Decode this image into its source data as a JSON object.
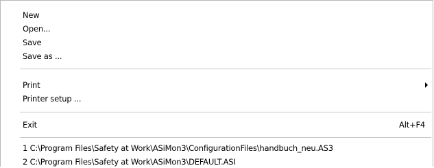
{
  "menu": {
    "items": [
      {
        "label": "New"
      },
      {
        "label": "Open..."
      },
      {
        "label": "Save"
      },
      {
        "label": "Save as ..."
      },
      {
        "label": "Print"
      },
      {
        "label": "Printer setup ..."
      },
      {
        "label": "Exit",
        "shortcut": "Alt+F4"
      },
      {
        "label": "1 C:\\Program Files\\Safety at Work\\ASiMon3\\ConfigurationFiles\\handbuch_neu.AS3"
      },
      {
        "label": "2 C:\\Program Files\\Safety at Work\\ASiMon3\\DEFAULT.ASI"
      }
    ]
  }
}
